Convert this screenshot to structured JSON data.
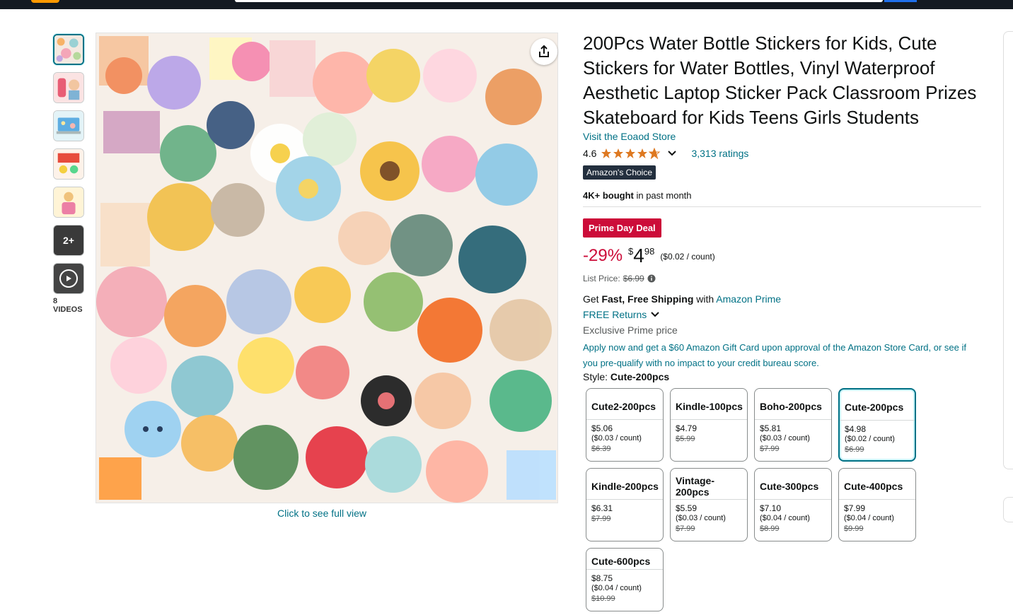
{
  "product": {
    "title": "200Pcs Water Bottle Stickers for Kids, Cute Stickers for Water Bottles, Vinyl Waterproof Aesthetic Laptop Sticker Pack Classroom Prizes Skateboard for Kids Teens Girls Students",
    "store_link": "Visit the Eoaod Store",
    "rating": "4.6",
    "ratings_count": "3,313 ratings",
    "badge": "Amazon's Choice",
    "bought_bold": "4K+ bought",
    "bought_rest": " in past month"
  },
  "gallery": {
    "more_label": "2+",
    "videos_label": "8 VIDEOS",
    "full_view": "Click to see full view"
  },
  "pricing": {
    "deal_badge": "Prime Day Deal",
    "discount": "-29%",
    "currency": "$",
    "whole": "4",
    "fraction": "98",
    "per_unit": "($0.02 / count)",
    "list_label": "List Price:",
    "list_price": "$6.99"
  },
  "shipping": {
    "get": "Get ",
    "fast_free": "Fast, Free Shipping",
    "with": " with ",
    "prime_link": "Amazon Prime",
    "returns": "FREE Returns",
    "exclusive": "Exclusive Prime price",
    "apply": "Apply now and get a $60 Amazon Gift Card upon approval of the Amazon Store Card, or see if you pre-qualify with no impact to your credit bureau score."
  },
  "style": {
    "label": "Style: ",
    "selected": "Cute-200pcs",
    "options": [
      {
        "name": "Cute2-200pcs",
        "price": "$5.06",
        "unit": "($0.03 / count)",
        "list": "$6.39"
      },
      {
        "name": "Kindle-100pcs",
        "price": "$4.79",
        "unit": "",
        "list": "$5.99"
      },
      {
        "name": "Boho-200pcs",
        "price": "$5.81",
        "unit": "($0.03 / count)",
        "list": "$7.99"
      },
      {
        "name": "Cute-200pcs",
        "price": "$4.98",
        "unit": "($0.02 / count)",
        "list": "$6.99"
      },
      {
        "name": "Kindle-200pcs",
        "price": "$6.31",
        "unit": "",
        "list": "$7.99"
      },
      {
        "name": "Vintage-200pcs",
        "price": "$5.59",
        "unit": "($0.03 / count)",
        "list": "$7.99"
      },
      {
        "name": "Cute-300pcs",
        "price": "$7.10",
        "unit": "($0.04 / count)",
        "list": "$8.99"
      },
      {
        "name": "Cute-400pcs",
        "price": "$7.99",
        "unit": "($0.04 / count)",
        "list": "$9.99"
      },
      {
        "name": "Cute-600pcs",
        "price": "$8.75",
        "unit": "($0.04 / count)",
        "list": "$10.99"
      }
    ]
  },
  "colors": {
    "link": "#007185",
    "deal": "#cc0c39",
    "star": "#de7921",
    "badge_bg": "#232f3e"
  }
}
